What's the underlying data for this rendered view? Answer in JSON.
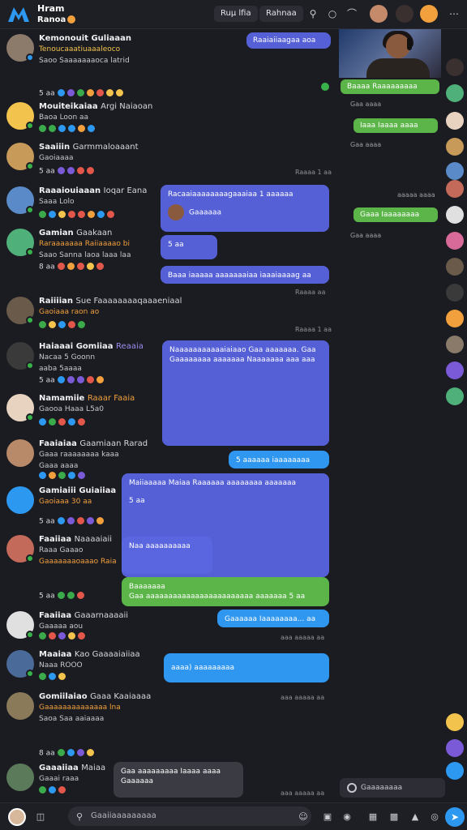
{
  "app": {
    "title_line1": "Hram",
    "title_line2": "Ranoa"
  },
  "topbar": {
    "tab1": "Ruμ lfia",
    "tab2": "Rahnaa"
  },
  "colors": {
    "background": "#1b1c21",
    "bubble_blue": "#5560d6",
    "bubble_green": "#5bb548",
    "bubble_sky": "#2f97ef",
    "online": "#38b24a"
  },
  "entries": [
    {
      "name": "Kemonouit Guliaaan",
      "badge": "",
      "line2": "Tenoucaaatiuaaaleoco",
      "line3": "Saoo Saaaaaaaoca latrid",
      "row": "5  aa"
    },
    {
      "name": "Mouiteikaiaa",
      "badge": "Argi Naiaoan",
      "line2": "Baoa Loon aa",
      "line3": "",
      "row": ""
    },
    {
      "name": "Saaiiin",
      "badge": "Garmmaloaaant",
      "line2": "Gaoiaaaa",
      "line3": "",
      "row": "5  aa"
    },
    {
      "name": "Raaaiouiaaan",
      "badge": "Ioqar Eana",
      "line2": "Saaa Lolo",
      "line3": "",
      "row": ""
    },
    {
      "name": "Gamian",
      "badge": "Gaakaan",
      "line2": "Raraaaaaaa Raiiaaaao bi",
      "line3": "Saao Sanna laoa laaa laa",
      "row": "8  aa"
    },
    {
      "name": "Raiiiian",
      "badge": "Sue Faaaaaaaaqaaaeniaal",
      "line2": "Gaoiaaa raon ao",
      "line3": "",
      "row": "aa"
    },
    {
      "name": "Haiaaai Gomiiaa",
      "badge": "Reaaia",
      "line2": "Nacaa 5 Goonn",
      "line3": "aaba 5aaaa",
      "row": "5  aa"
    },
    {
      "name": "Namamiie",
      "badge": "Raaar Faaia",
      "line2": "Gaooa Haaa L5a0",
      "line3": "",
      "row": ""
    },
    {
      "name": "Faaiaiaa",
      "badge": "Gaamiaan Rarad",
      "line2": "Gaaa raaaaaaaa kaaa",
      "line3": "Gaaa aaaa",
      "row": ""
    },
    {
      "name": "Gamiaiii Guiaiiaa",
      "badge": "",
      "line2": "Gaoiaaa 30 aa",
      "line3": "",
      "row": "5  aa"
    },
    {
      "name": "Faaiiaa",
      "badge": "Naaaaiaii",
      "line2": "Raaa Gaaao",
      "line3": "Gaaaaaaaoaaao Raia",
      "row": "5  aa"
    },
    {
      "name": "Faaiiaa",
      "badge": "Gaaarnaaaaii",
      "line2": "Gaaaaa aou",
      "line3": "",
      "row": "aa"
    },
    {
      "name": "Maaiaa",
      "badge": "Kao Gaaaaiaiiaa",
      "line2": "Naaa ROOO",
      "line3": "",
      "row": "aa"
    },
    {
      "name": "Gomiilaiao",
      "badge": "Gaaa Kaaiaaaa",
      "line2": "Gaaaaaaaaaaaaaa lna",
      "line3": "Saoa Saa aaiaaaa",
      "row": "8  aa"
    },
    {
      "name": "Gaaaiiaa",
      "badge": "Maiaa",
      "line2": "Gaaai raaa",
      "line3": "",
      "row": "aa"
    }
  ],
  "bubbles": {
    "b1": "Raaiaiiaagaa aoa",
    "b2": "Racaaiaaaaaaaagaaaiaa 1 aaaaaa",
    "b2_sub": "Gaaaaaa",
    "b3": "5 aa",
    "b4": "Baaa iaaaaa aaaaaaaiaa iaaaiaaaag aa",
    "b5": "Naaaaaaaaaaaiaiaao Gaa aaaaaaa. Gaa Gaaaaaaaa aaaaaaa Naaaaaaa aaa aaa",
    "b6": "5 aaaaaa iaaaaaaaa",
    "b7": "Maiiaaaaa Maiaa Raaaaaa aaaaaaaa aaaaaaa",
    "b7_sub": "5 aa",
    "b8": "Naa aaaaaaaaaa",
    "b9": "Baaaaaaa",
    "b9_sub": "Gaa aaaaaaaaaaaaaaaaaaaaaaaa aaaaaaa 5 aa",
    "b10": "Gaaaaaa Iaaaaaaaa... aa",
    "b11": "aaaa) aaaaaaaaa",
    "b12": "Gaa aaaaaaaaa Iaaaa aaaa",
    "b12_sub": "Gaaaaaa"
  },
  "timestamps": {
    "t1": "Raaaa 1 aa",
    "t2": "Raaaa aa",
    "t3": "Raaaa 1 aa",
    "t4": "aaa aaaaa aa",
    "t5": "aaa aaaaa aa",
    "t6": "aaa aaaaa aa"
  },
  "right": {
    "r1": "Baaaa Raaaaaaaaa",
    "r1_s": "Gaa aaaa",
    "r2": "Iaaa Iaaaa aaaa",
    "r2_s": "Gaa aaaa",
    "r3": "Gaaa Iaaaaaaaa",
    "r3_s": "Gaa aaaa",
    "r_time": "aaaaa aaaa"
  },
  "right_input": "Gaaaaaaaa",
  "composer": {
    "placeholder": "Gaaiiaaaaaaaaa"
  }
}
